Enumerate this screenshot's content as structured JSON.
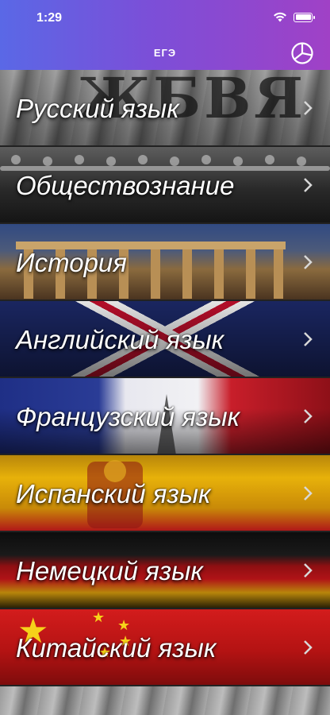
{
  "status_bar": {
    "time": "1:29"
  },
  "nav": {
    "title": "ЕГЭ",
    "action_icon": "pie-chart-icon"
  },
  "subjects": [
    {
      "label": "Русский язык"
    },
    {
      "label": "Обществознание"
    },
    {
      "label": "История"
    },
    {
      "label": "Английский язык"
    },
    {
      "label": "Французский язык"
    },
    {
      "label": "Испанский язык"
    },
    {
      "label": "Немецкий язык"
    },
    {
      "label": "Китайский язык"
    }
  ],
  "colors": {
    "header_gradient_start": "#5a68e6",
    "header_gradient_end": "#a041c6",
    "label_text": "#ffffff"
  }
}
